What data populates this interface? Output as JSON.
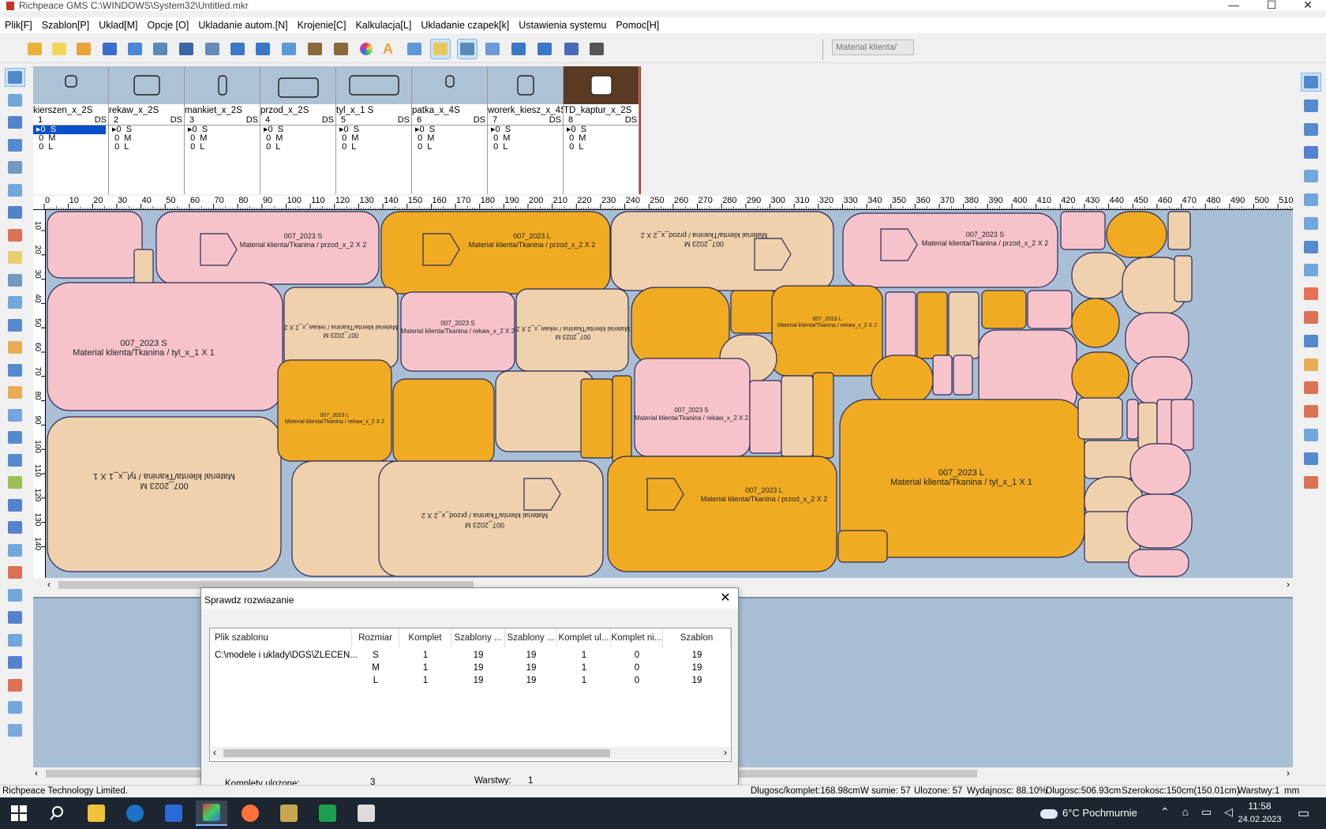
{
  "window": {
    "title": "Richpeace GMS C:\\WINDOWS\\System32\\Untitled.mkr",
    "minimize_glyph": "—",
    "maximize_glyph": "☐",
    "close_glyph": "✕"
  },
  "menu": [
    "Plik[F]",
    "Szablon[P]",
    "Uklad[M]",
    "Opcje [O]",
    "Ukladanie autom.[N]",
    "Krojenie[C]",
    "Kalkulacja[L]",
    "Ukladanie czapek[k]",
    "Ustawienia systemu",
    "Pomoc[H]"
  ],
  "toolbar": {
    "icons": [
      "open-folder-icon",
      "new-file-icon",
      "open-file-icon",
      "pattern-icon",
      "save-icon",
      "print-icon",
      "plotter-icon",
      "preview-icon",
      "undo-icon",
      "redo-icon",
      "import-icon",
      "tools-icon",
      "settings-icon",
      "color-wheel-icon",
      "text-icon",
      "image-icon",
      "layout-a-icon",
      "layout-b-icon",
      "grid-icon",
      "rotate-icon",
      "flip-icon",
      "cut-icon",
      "delete-icon"
    ],
    "material_select": "Material klienta/"
  },
  "patterns": [
    {
      "name": "kierszen_x_2S",
      "num": "1",
      "ds": "DS"
    },
    {
      "name": "rekaw_x_2S",
      "num": "2",
      "ds": "DS"
    },
    {
      "name": "mankiet_x_2S",
      "num": "3",
      "ds": "DS"
    },
    {
      "name": "przod_x_2S",
      "num": "4",
      "ds": "DS"
    },
    {
      "name": "tyl_x_1 S",
      "num": "5",
      "ds": "DS"
    },
    {
      "name": "patka_x_4S",
      "num": "6",
      "ds": "DS"
    },
    {
      "name": "worerk_kiesz_x_4S",
      "num": "7",
      "ds": "DS"
    },
    {
      "name": "TD_kaptur_x_2S",
      "num": "8",
      "ds": "DS"
    }
  ],
  "size_rows": [
    "0  S",
    "0  M",
    "0  L"
  ],
  "ruler_labels": [
    "0",
    "10",
    "20",
    "30",
    "40",
    "50",
    "60",
    "70",
    "80",
    "90",
    "100",
    "110",
    "120",
    "130",
    "140",
    "150",
    "160",
    "170",
    "180",
    "190",
    "200",
    "210",
    "220",
    "230",
    "240",
    "250",
    "260",
    "270",
    "280",
    "290",
    "300",
    "310",
    "320",
    "330",
    "340",
    "350",
    "360",
    "370",
    "380",
    "390",
    "400",
    "410",
    "420",
    "430",
    "440",
    "450",
    "460",
    "470",
    "480",
    "490",
    "500",
    "510"
  ],
  "vruler_labels": [
    "10",
    "20",
    "30",
    "40",
    "50",
    "60",
    "70",
    "80",
    "90",
    "100",
    "110",
    "120",
    "130",
    "140"
  ],
  "marker": {
    "colors": {
      "S": "#f7c3cb",
      "M": "#f0d1ae",
      "L": "#f0ab22",
      "bg": "#a9bfd6",
      "outline": "#2a2a55"
    },
    "labels": {
      "s_przod": "007_2023 S",
      "s_przod_sub": "Material klienta/Tkanina / przod_x_2 X 2",
      "l_przod": "007_2023 L",
      "l_przod_sub": "Material klienta/Tkanina / przod_x_2 X 2",
      "m_przod": "007_2023 M",
      "m_przod_sub": "Material klienta/Tkanina / przod_x_2 X 2",
      "s_tyl": "007_2023 S",
      "s_tyl_sub": "Material klienta/Tkanina / tyl_x_1 X 1",
      "m_tyl": "007_2023 M",
      "m_tyl_sub": "Material klienta/Tkanina / tyl_x_1 X 1",
      "l_tyl": "007_2023 L",
      "l_tyl_sub": "Material klienta/Tkanina / tyl_x_1 X 1",
      "s_rekaw": "007_2023 S",
      "s_rekaw_sub": "Material klienta/Tkanina / rekaw_x_2 X 2",
      "m_rekaw": "007_2023 M",
      "m_rekaw_sub": "Material klienta/Tkanina / rekaw_x_2 X 2",
      "l_rekaw": "007_2023 L",
      "l_rekaw_sub": "Material klienta/Tkanina / rekaw_x_2 X 2"
    }
  },
  "dialog": {
    "title": "Sprawdz rozwiazanie",
    "close": "✕",
    "columns": [
      "Plik szablonu",
      "Rozmiar",
      "Komplet",
      "Szablony ...",
      "Szablony ...",
      "Komplet ul...",
      "Komplet ni...",
      "Szablon"
    ],
    "rows": [
      [
        "C:\\modele i uklady\\DGS\\ZLECEN...",
        "S",
        "1",
        "19",
        "19",
        "1",
        "0",
        "19"
      ],
      [
        "",
        "M",
        "1",
        "19",
        "19",
        "1",
        "0",
        "19"
      ],
      [
        "",
        "L",
        "1",
        "19",
        "19",
        "1",
        "0",
        "19"
      ]
    ],
    "komplety_label": "Komplety ulozone:",
    "komplety_value": "3",
    "warstwy_label": "Warstwy:",
    "warstwy_value": "1"
  },
  "status": {
    "company": "Richpeace Technology Limited.",
    "dlugosc_komplet": "Dlugosc/komplet:168.98cm",
    "w_sumie": "W sumie: 57",
    "ulozone": "Ulozone: 57",
    "wydajnosc": "Wydajnosc: 88.10%",
    "dlugosc": "Dlugosc:506.93cm",
    "szerokosc": "Szerokosc:150cm(150.01cm)",
    "warstwy": "Warstwy:1",
    "unit": "mm"
  },
  "taskbar": {
    "weather": "6°C  Pochmurnie",
    "time": "11:58",
    "date": "24.02.2023"
  }
}
